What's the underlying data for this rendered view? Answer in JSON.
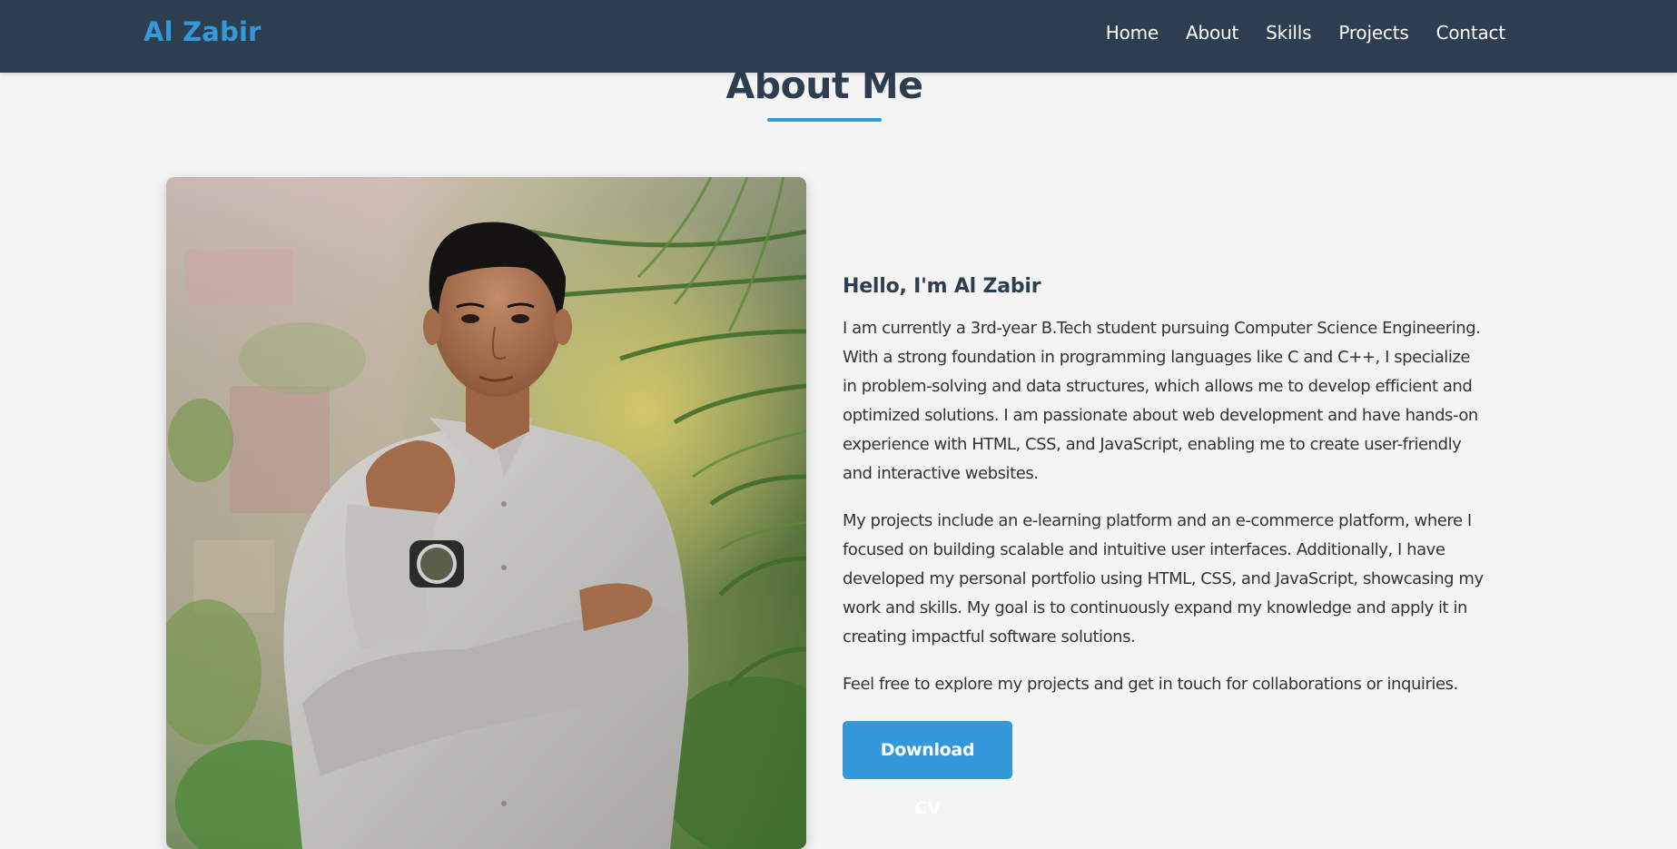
{
  "header": {
    "logo": "Al Zabir",
    "nav": [
      "Home",
      "About",
      "Skills",
      "Projects",
      "Contact"
    ]
  },
  "about": {
    "section_title": "About Me",
    "greeting": "Hello, I'm Al Zabir",
    "paragraphs": [
      "I am currently a 3rd-year B.Tech student pursuing Computer Science Engineering. With a strong foundation in programming languages like C and C++, I specialize in problem-solving and data structures, which allows me to develop efficient and optimized solutions. I am passionate about web development and have hands-on experience with HTML, CSS, and JavaScript, enabling me to create user-friendly and interactive websites.",
      "My projects include an e-learning platform and an e-commerce platform, where I focused on building scalable and intuitive user interfaces. Additionally, I have developed my personal portfolio using HTML, CSS, and JavaScript, showcasing my work and skills. My goal is to continuously expand my knowledge and apply it in creating impactful software solutions.",
      "Feel free to explore my projects and get in touch for collaborations or inquiries."
    ],
    "cv_button": "Download CV"
  },
  "colors": {
    "navbar": "#2c3e50",
    "accent": "#3498db",
    "background": "#f4f4f4",
    "heading": "#2c3e50",
    "text": "#333333"
  }
}
